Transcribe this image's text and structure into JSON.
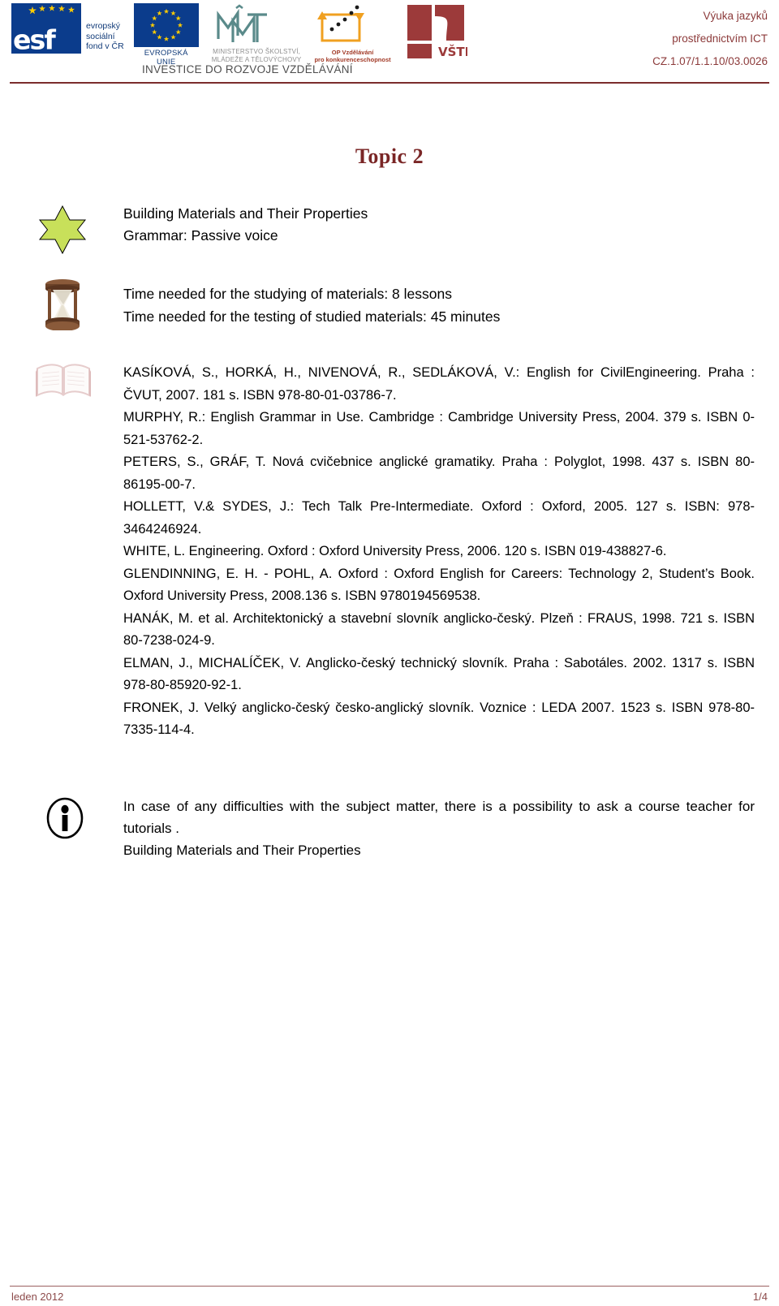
{
  "header": {
    "logos": [
      {
        "name": "esf-logo",
        "title": "esf",
        "lines": [
          "evropský",
          "sociální",
          "fond v ČR"
        ]
      },
      {
        "name": "eu-flag-logo",
        "caption": "EVROPSKÁ UNIE"
      },
      {
        "name": "msmt-logo",
        "caption_line1": "MINISTERSTVO ŠKOLSTVÍ,",
        "caption_line2": "MLÁDEŽE A TĚLOVÝCHOVY"
      },
      {
        "name": "op-vzdelavani-logo",
        "caption_line1": "OP Vzdělávání",
        "caption_line2": "pro konkurenceschopnost"
      },
      {
        "name": "vste-logo",
        "caption": "VŠTE"
      }
    ],
    "investment_slogan": "INVESTICE DO ROZVOJE VZDĚLÁVÁNÍ",
    "right": {
      "line1": "Výuka jazyků",
      "line2": "prostřednictvím ICT",
      "line3": "CZ.1.07/1.1.10/03.0026"
    },
    "accent_color": "#7b2d2d"
  },
  "title": "Topic 2",
  "intro": {
    "line1": "Building Materials and Their Properties",
    "line2": "Grammar: Passive voice"
  },
  "timing": {
    "line1": "Time needed for the studying of materials: 8 lessons",
    "line2": "Time needed for the testing of studied materials: 45 minutes"
  },
  "bibliography": [
    "KASÍKOVÁ, S., HORKÁ, H., NIVENOVÁ, R., SEDLÁKOVÁ, V.: English for CivilEngineering. Praha : ČVUT, 2007. 181 s. ISBN 978-80-01-03786-7.",
    "MURPHY, R.: English Grammar in Use. Cambridge : Cambridge University Press, 2004. 379 s. ISBN 0-521-53762-2.",
    "PETERS, S., GRÁF, T. Nová cvičebnice anglické gramatiky. Praha : Polyglot, 1998. 437 s. ISBN 80-86195-00-7.",
    "HOLLETT, V.& SYDES, J.: Tech Talk Pre-Intermediate. Oxford : Oxford, 2005. 127 s. ISBN: 978-3464246924.",
    "WHITE, L. Engineering. Oxford : Oxford University Press, 2006. 120 s. ISBN 019-438827-6.",
    "GLENDINNING, E. H. - POHL, A. Oxford : Oxford English for Careers: Technology 2, Student’s Book. Oxford University Press, 2008.136 s. ISBN 9780194569538.",
    "HANÁK, M. et al. Architektonický a stavební slovník anglicko-český. Plzeň : FRAUS, 1998. 721 s. ISBN 80-7238-024-9.",
    "ELMAN, J., MICHALÍČEK, V. Anglicko-český technický slovník. Praha : Sabotáles. 2002. 1317 s. ISBN 978-80-85920-92-1.",
    "FRONEK, J. Velký anglicko-český česko-anglický slovník. Voznice : LEDA 2007. 1523 s. ISBN 978-80-7335-114-4."
  ],
  "notice": {
    "line1": "In case of any difficulties with the subject matter, there is a possibility to ask  a course teacher for tutorials .",
    "line2": "Building Materials and Their Properties"
  },
  "icons": {
    "star": "star-icon",
    "hourglass": "hourglass-icon",
    "book": "book-icon",
    "info": "info-icon"
  },
  "footer": {
    "left": "leden 2012",
    "right": "1/4"
  }
}
